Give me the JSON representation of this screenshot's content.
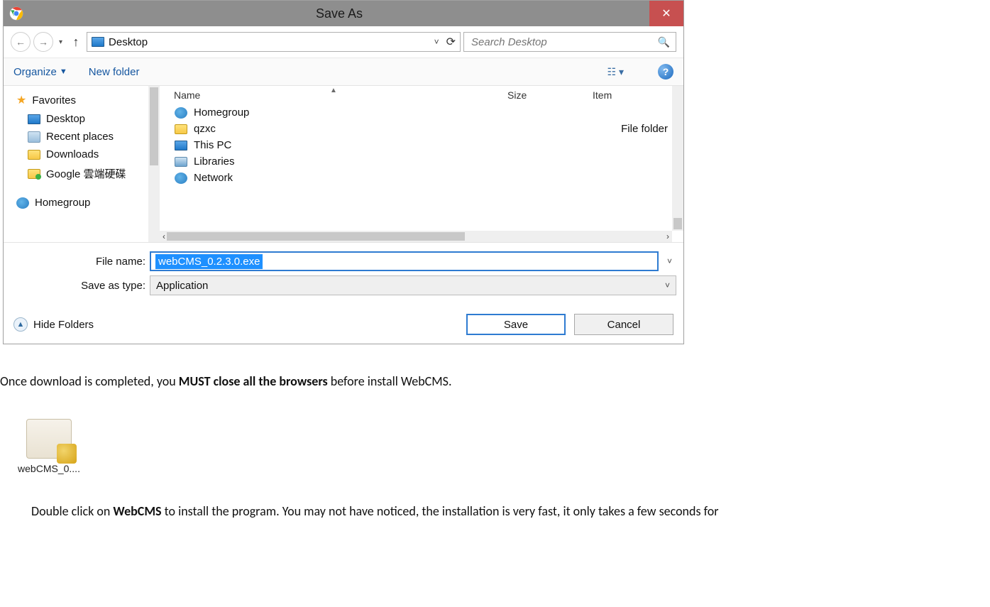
{
  "dialog": {
    "title": "Save As",
    "location": "Desktop",
    "search_placeholder": "Search Desktop",
    "organize": "Organize",
    "new_folder": "New folder",
    "help": "?"
  },
  "sidebar": {
    "favorites": "Favorites",
    "items": [
      {
        "label": "Desktop"
      },
      {
        "label": "Recent places"
      },
      {
        "label": "Downloads"
      },
      {
        "label": "Google 雲端硬碟"
      }
    ],
    "homegroup": "Homegroup"
  },
  "columns": {
    "name": "Name",
    "size": "Size",
    "item": "Item"
  },
  "rows": [
    {
      "label": "Homegroup"
    },
    {
      "label": "qzxc",
      "type": "File folder"
    },
    {
      "label": "This PC"
    },
    {
      "label": "Libraries"
    },
    {
      "label": "Network"
    }
  ],
  "form": {
    "file_name_label": "File name:",
    "file_name_value": "webCMS_0.2.3.0.exe",
    "save_type_label": "Save as type:",
    "save_type_value": "Application"
  },
  "buttons": {
    "hide_folders": "Hide Folders",
    "save": "Save",
    "cancel": "Cancel"
  },
  "text": {
    "p1_a": "Once download is completed, you ",
    "p1_b": "MUST close all the browsers",
    "p1_c": " before install WebCMS.",
    "installer_name": "webCMS_0....",
    "p2_a": "Double click on ",
    "p2_b": "WebCMS",
    "p2_c": " to install the program. You may not have noticed, the installation is very fast, it only takes a few seconds for"
  }
}
